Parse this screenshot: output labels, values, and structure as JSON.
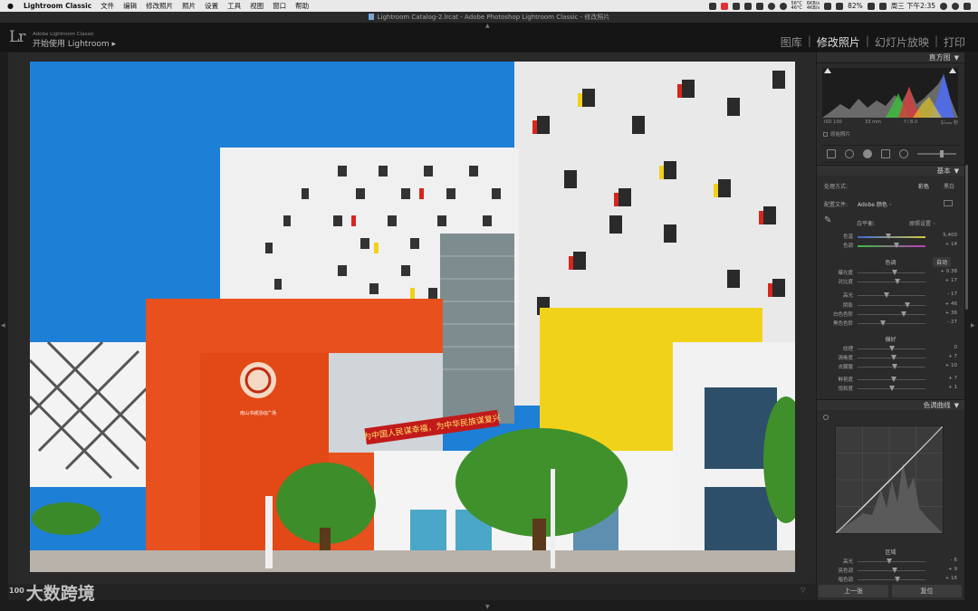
{
  "menubar": {
    "app": "Lightroom Classic",
    "items": [
      "文件",
      "编辑",
      "修改照片",
      "照片",
      "设置",
      "工具",
      "视图",
      "窗口",
      "帮助"
    ],
    "battery": "82%",
    "clock": "周三 下午2:35",
    "weather_temp_top": "56°C",
    "weather_temp_bottom": "46°C",
    "net_top": "6KB/s",
    "net_bottom": "4KB/s"
  },
  "window": {
    "title": "Lightroom Catalog-2.lrcat - Adobe Photoshop Lightroom Classic - 修改照片"
  },
  "identity": {
    "logo": "Lr",
    "line1": "Adobe Lightroom Classic",
    "line2": "开始使用 Lightroom  ▸"
  },
  "modules": {
    "library": "图库",
    "develop": "修改照片",
    "slideshow": "幻灯片放映",
    "print": "打印",
    "separator": "|"
  },
  "histogram": {
    "title": "直方图",
    "iso": "ISO 100",
    "focal": "33 mm",
    "aperture": "f / 8.0",
    "shutter": "1/₁₀₀₀ 秒",
    "original_photo": "原始照片"
  },
  "basic": {
    "title": "基本",
    "treatment_label": "处理方式:",
    "treatment_color": "彩色",
    "treatment_bw": "黑白",
    "profile_label": "配置文件:",
    "profile_value": "Adobe 颜色 ◦",
    "wb_label": "白平衡:",
    "wb_value": "原照设置 ◦",
    "tone_label": "色调",
    "auto_label": "自动",
    "presence_label": "偏好",
    "sliders": [
      {
        "name": "色温",
        "value": "5,400",
        "pos": 0.45
      },
      {
        "name": "色调",
        "value": "+ 14",
        "pos": 0.57
      },
      {
        "name": "曝光度",
        "value": "+ 0.38",
        "pos": 0.54
      },
      {
        "name": "对比度",
        "value": "+ 17",
        "pos": 0.58
      },
      {
        "name": "高光",
        "value": "- 17",
        "pos": 0.42
      },
      {
        "name": "阴影",
        "value": "+ 46",
        "pos": 0.73
      },
      {
        "name": "白色色阶",
        "value": "+ 36",
        "pos": 0.68
      },
      {
        "name": "黑色色阶",
        "value": "- 27",
        "pos": 0.37
      },
      {
        "name": "纹理",
        "value": "0",
        "pos": 0.5
      },
      {
        "name": "清晰度",
        "value": "+ 7",
        "pos": 0.53
      },
      {
        "name": "去朦胧",
        "value": "+ 10",
        "pos": 0.55
      },
      {
        "name": "鲜艳度",
        "value": "+ 7",
        "pos": 0.53
      },
      {
        "name": "饱和度",
        "value": "+ 1",
        "pos": 0.51
      }
    ]
  },
  "tone_curve": {
    "title": "色调曲线",
    "region_label": "区域",
    "sliders": [
      {
        "name": "高光",
        "value": "- 6",
        "pos": 0.47
      },
      {
        "name": "亮色调",
        "value": "+ 9",
        "pos": 0.54
      },
      {
        "name": "暗色调",
        "value": "+ 16",
        "pos": 0.58
      }
    ]
  },
  "buttons": {
    "previous": "上一张",
    "reset": "复位"
  },
  "watermark": {
    "prefix": "100",
    "text": "大数跨境"
  },
  "photo": {
    "banner_text": "为中国人民谋幸福，为中华民族谋复兴",
    "sign_text": "南山书城活动广场",
    "sign_sub": "Nanshan Bookcity Plaza"
  },
  "colors": {
    "sky": "#1e7fd6",
    "orange": "#e8501e",
    "yellow": "#f1d21a",
    "panel_bg": "#2b2b2b",
    "banner_red": "#c21a1a"
  }
}
